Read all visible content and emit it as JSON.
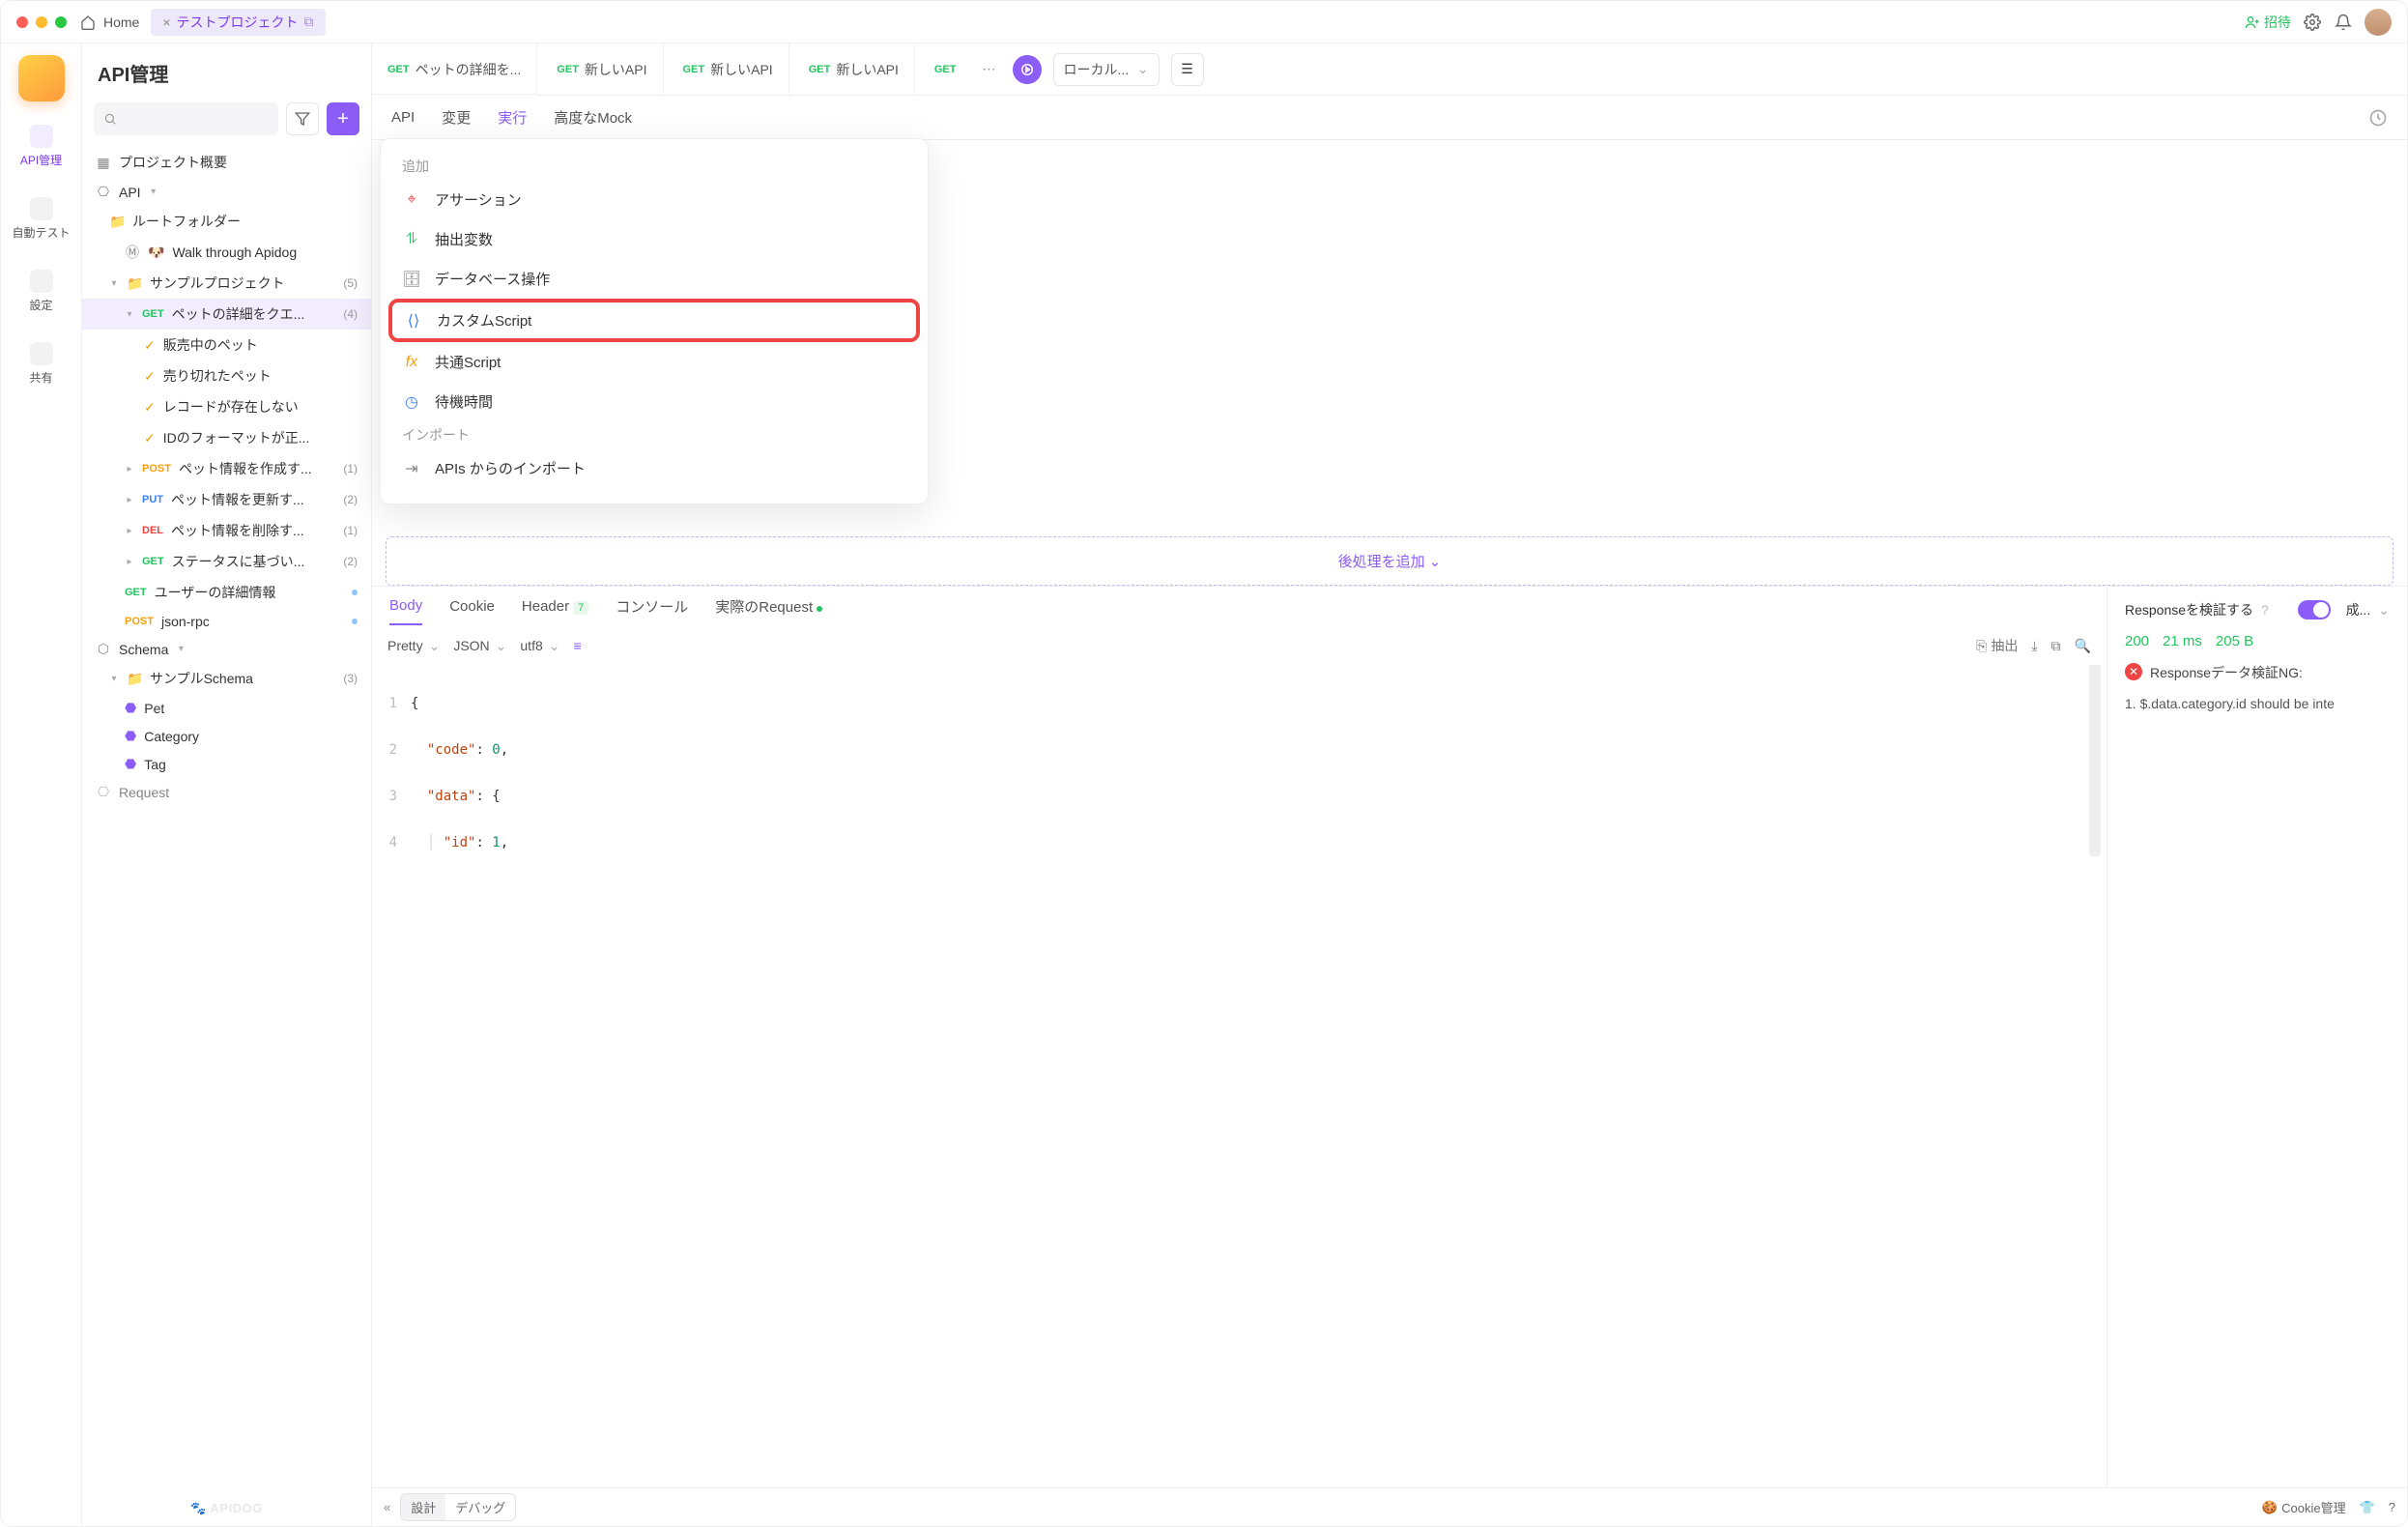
{
  "titlebar": {
    "home": "Home",
    "project": "テストプロジェクト",
    "invite": "招待"
  },
  "rail": {
    "api": "API管理",
    "autotest": "自動テスト",
    "settings": "設定",
    "share": "共有"
  },
  "tree": {
    "title": "API管理",
    "overview": "プロジェクト概要",
    "api_root": "API",
    "root_folder": "ルートフォルダー",
    "walk": "Walk through Apidog",
    "sample_project": "サンプルプロジェクト",
    "sample_project_count": "(5)",
    "get_pet": "ペットの詳細をクエ...",
    "get_pet_count": "(4)",
    "c1": "販売中のペット",
    "c2": "売り切れたペット",
    "c3": "レコードが存在しない",
    "c4": "IDのフォーマットが正...",
    "post_pet": "ペット情報を作成す...",
    "post_pet_count": "(1)",
    "put_pet": "ペット情報を更新す...",
    "put_pet_count": "(2)",
    "del_pet": "ペット情報を削除す...",
    "del_pet_count": "(1)",
    "get_status": "ステータスに基づい...",
    "get_status_count": "(2)",
    "get_user": "ユーザーの詳細情報",
    "post_json": "json-rpc",
    "schema": "Schema",
    "sample_schema": "サンプルSchema",
    "sample_schema_count": "(3)",
    "s1": "Pet",
    "s2": "Category",
    "s3": "Tag",
    "request": "Request",
    "watermark": "🐾 APIDOG"
  },
  "tabs": {
    "t1": "ペットの詳細を...",
    "t2": "新しいAPI",
    "t3": "新しいAPI",
    "t4": "新しいAPI",
    "t5": "",
    "env": "ローカル..."
  },
  "subtabs": {
    "api": "API",
    "change": "変更",
    "run": "実行",
    "mock": "高度なMock"
  },
  "popover": {
    "add": "追加",
    "assert": "アサーション",
    "extract": "抽出変数",
    "db": "データベース操作",
    "custom": "カスタムScript",
    "common": "共通Script",
    "wait": "待機時間",
    "import": "インポート",
    "from_api": "APIs からのインポート"
  },
  "add_post": "後処理を追加",
  "resp_tabs": {
    "body": "Body",
    "cookie": "Cookie",
    "header": "Header",
    "header_n": "7",
    "console": "コンソール",
    "actual": "実際のRequest"
  },
  "resp_tools": {
    "pretty": "Pretty",
    "json": "JSON",
    "utf8": "utf8",
    "extract": "抽出"
  },
  "code": {
    "l1": "{",
    "l2a": "\"code\"",
    "l2b": ": ",
    "l2c": "0",
    "l2d": ",",
    "l3a": "\"data\"",
    "l3b": ": {",
    "l4a": "\"id\"",
    "l4b": ": ",
    "l4c": "1",
    "l4d": ","
  },
  "resp_right": {
    "validate": "Responseを検証する",
    "status_label": "成...",
    "code": "200",
    "time": "21 ms",
    "size": "205 B",
    "err_title": "Responseデータ検証NG:",
    "err_1": "1. $.data.category.id should be inte"
  },
  "footer": {
    "design": "設計",
    "debug": "デバッグ",
    "cookie": "Cookie管理"
  },
  "methods": {
    "get": "GET",
    "post": "POST",
    "put": "PUT",
    "del": "DEL"
  }
}
